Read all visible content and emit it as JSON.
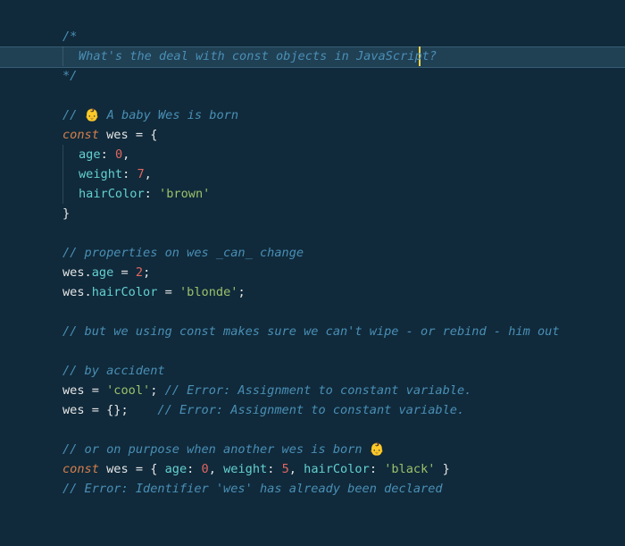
{
  "code": {
    "lines": [
      {
        "t": "c",
        "v": "/*"
      },
      {
        "t": "c-indent",
        "v": "What's the deal with const objects in JavaScript?"
      },
      {
        "t": "c",
        "v": "*/"
      },
      {
        "t": "blank",
        "v": ""
      },
      {
        "t": "baby",
        "pre": "// ",
        "emoji": "👶",
        "post": " A baby Wes is born"
      },
      {
        "t": "constopen",
        "kw": "const",
        "sp": " ",
        "name": "wes",
        "rest": " = {"
      },
      {
        "t": "prop",
        "pad": "  ",
        "name": "age",
        "colon": ": ",
        "val": "0",
        "comma": ",",
        "vt": "num"
      },
      {
        "t": "prop",
        "pad": "  ",
        "name": "weight",
        "colon": ": ",
        "val": "7",
        "comma": ",",
        "vt": "num"
      },
      {
        "t": "prop",
        "pad": "  ",
        "name": "hairColor",
        "colon": ": ",
        "val": "'brown'",
        "comma": "",
        "vt": "str"
      },
      {
        "t": "id",
        "v": "}"
      },
      {
        "t": "blank",
        "v": ""
      },
      {
        "t": "c",
        "v": "// properties on wes _can_ change"
      },
      {
        "t": "assign-num",
        "obj": "wes",
        "dot": ".",
        "prop": "age",
        "rest": " = ",
        "val": "2",
        "end": ";"
      },
      {
        "t": "assign-str",
        "obj": "wes",
        "dot": ".",
        "prop": "hairColor",
        "rest": " = ",
        "val": "'blonde'",
        "end": ";"
      },
      {
        "t": "blank",
        "v": ""
      },
      {
        "t": "c",
        "v": "// but we using const makes sure we can't wipe - or rebind - him out"
      },
      {
        "t": "blank",
        "v": ""
      },
      {
        "t": "c",
        "v": "// by accident"
      },
      {
        "t": "err-str",
        "lhs": "wes = ",
        "val": "'cool'",
        "mid": "; ",
        "cmt": "// Error: Assignment to constant variable."
      },
      {
        "t": "err-obj",
        "lhs": "wes = {};",
        "pad": "    ",
        "cmt": "// Error: Assignment to constant variable."
      },
      {
        "t": "blank",
        "v": ""
      },
      {
        "t": "born",
        "pre": "// or on purpose when another wes is born ",
        "emoji": "👶"
      },
      {
        "t": "constobj",
        "kw": "const",
        "sp": " ",
        "name": "wes",
        "eq": " = { ",
        "p1": "age",
        "c1": ": ",
        "v1": "0",
        "s1": ", ",
        "p2": "weight",
        "c2": ": ",
        "v2": "5",
        "s2": ", ",
        "p3": "hairColor",
        "c3": ": ",
        "v3": "'black'",
        "close": " }"
      },
      {
        "t": "c",
        "v": "// Error: Identifier 'wes' has already been declared"
      }
    ]
  },
  "colors": {
    "background": "#102A3B",
    "comment": "#4A8FB5",
    "keyword": "#D67F4B",
    "property": "#64D0CF",
    "number": "#E2665F",
    "string": "#9CC16B",
    "cursor": "#F7D547"
  }
}
